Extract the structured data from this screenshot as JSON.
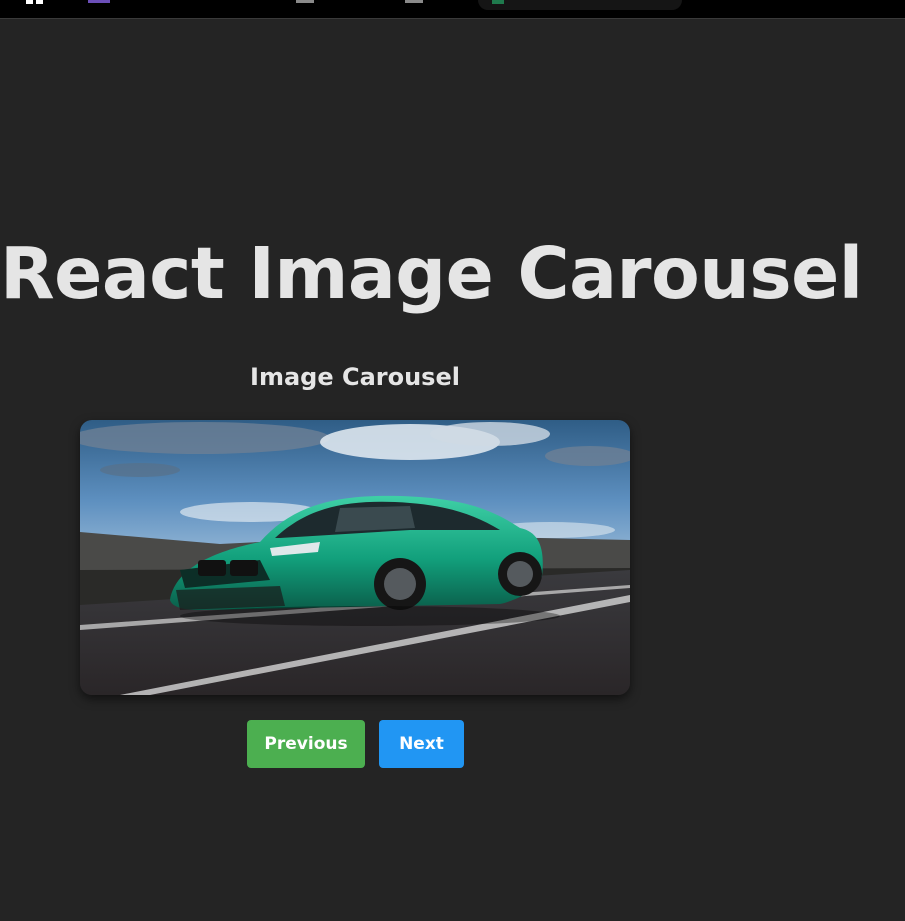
{
  "page": {
    "title": "React Image Carousel"
  },
  "carousel": {
    "heading": "Image Carousel",
    "image_alt": "green sedan car on road",
    "buttons": {
      "previous_label": "Previous",
      "next_label": "Next"
    }
  },
  "colors": {
    "background": "#242424",
    "text": "#e5e5e5",
    "previous_button": "#4caf50",
    "next_button": "#2196f3"
  },
  "icons": [
    "app-grid-icon",
    "app-icon",
    "document-icon",
    "document-icon",
    "tab-icon"
  ]
}
